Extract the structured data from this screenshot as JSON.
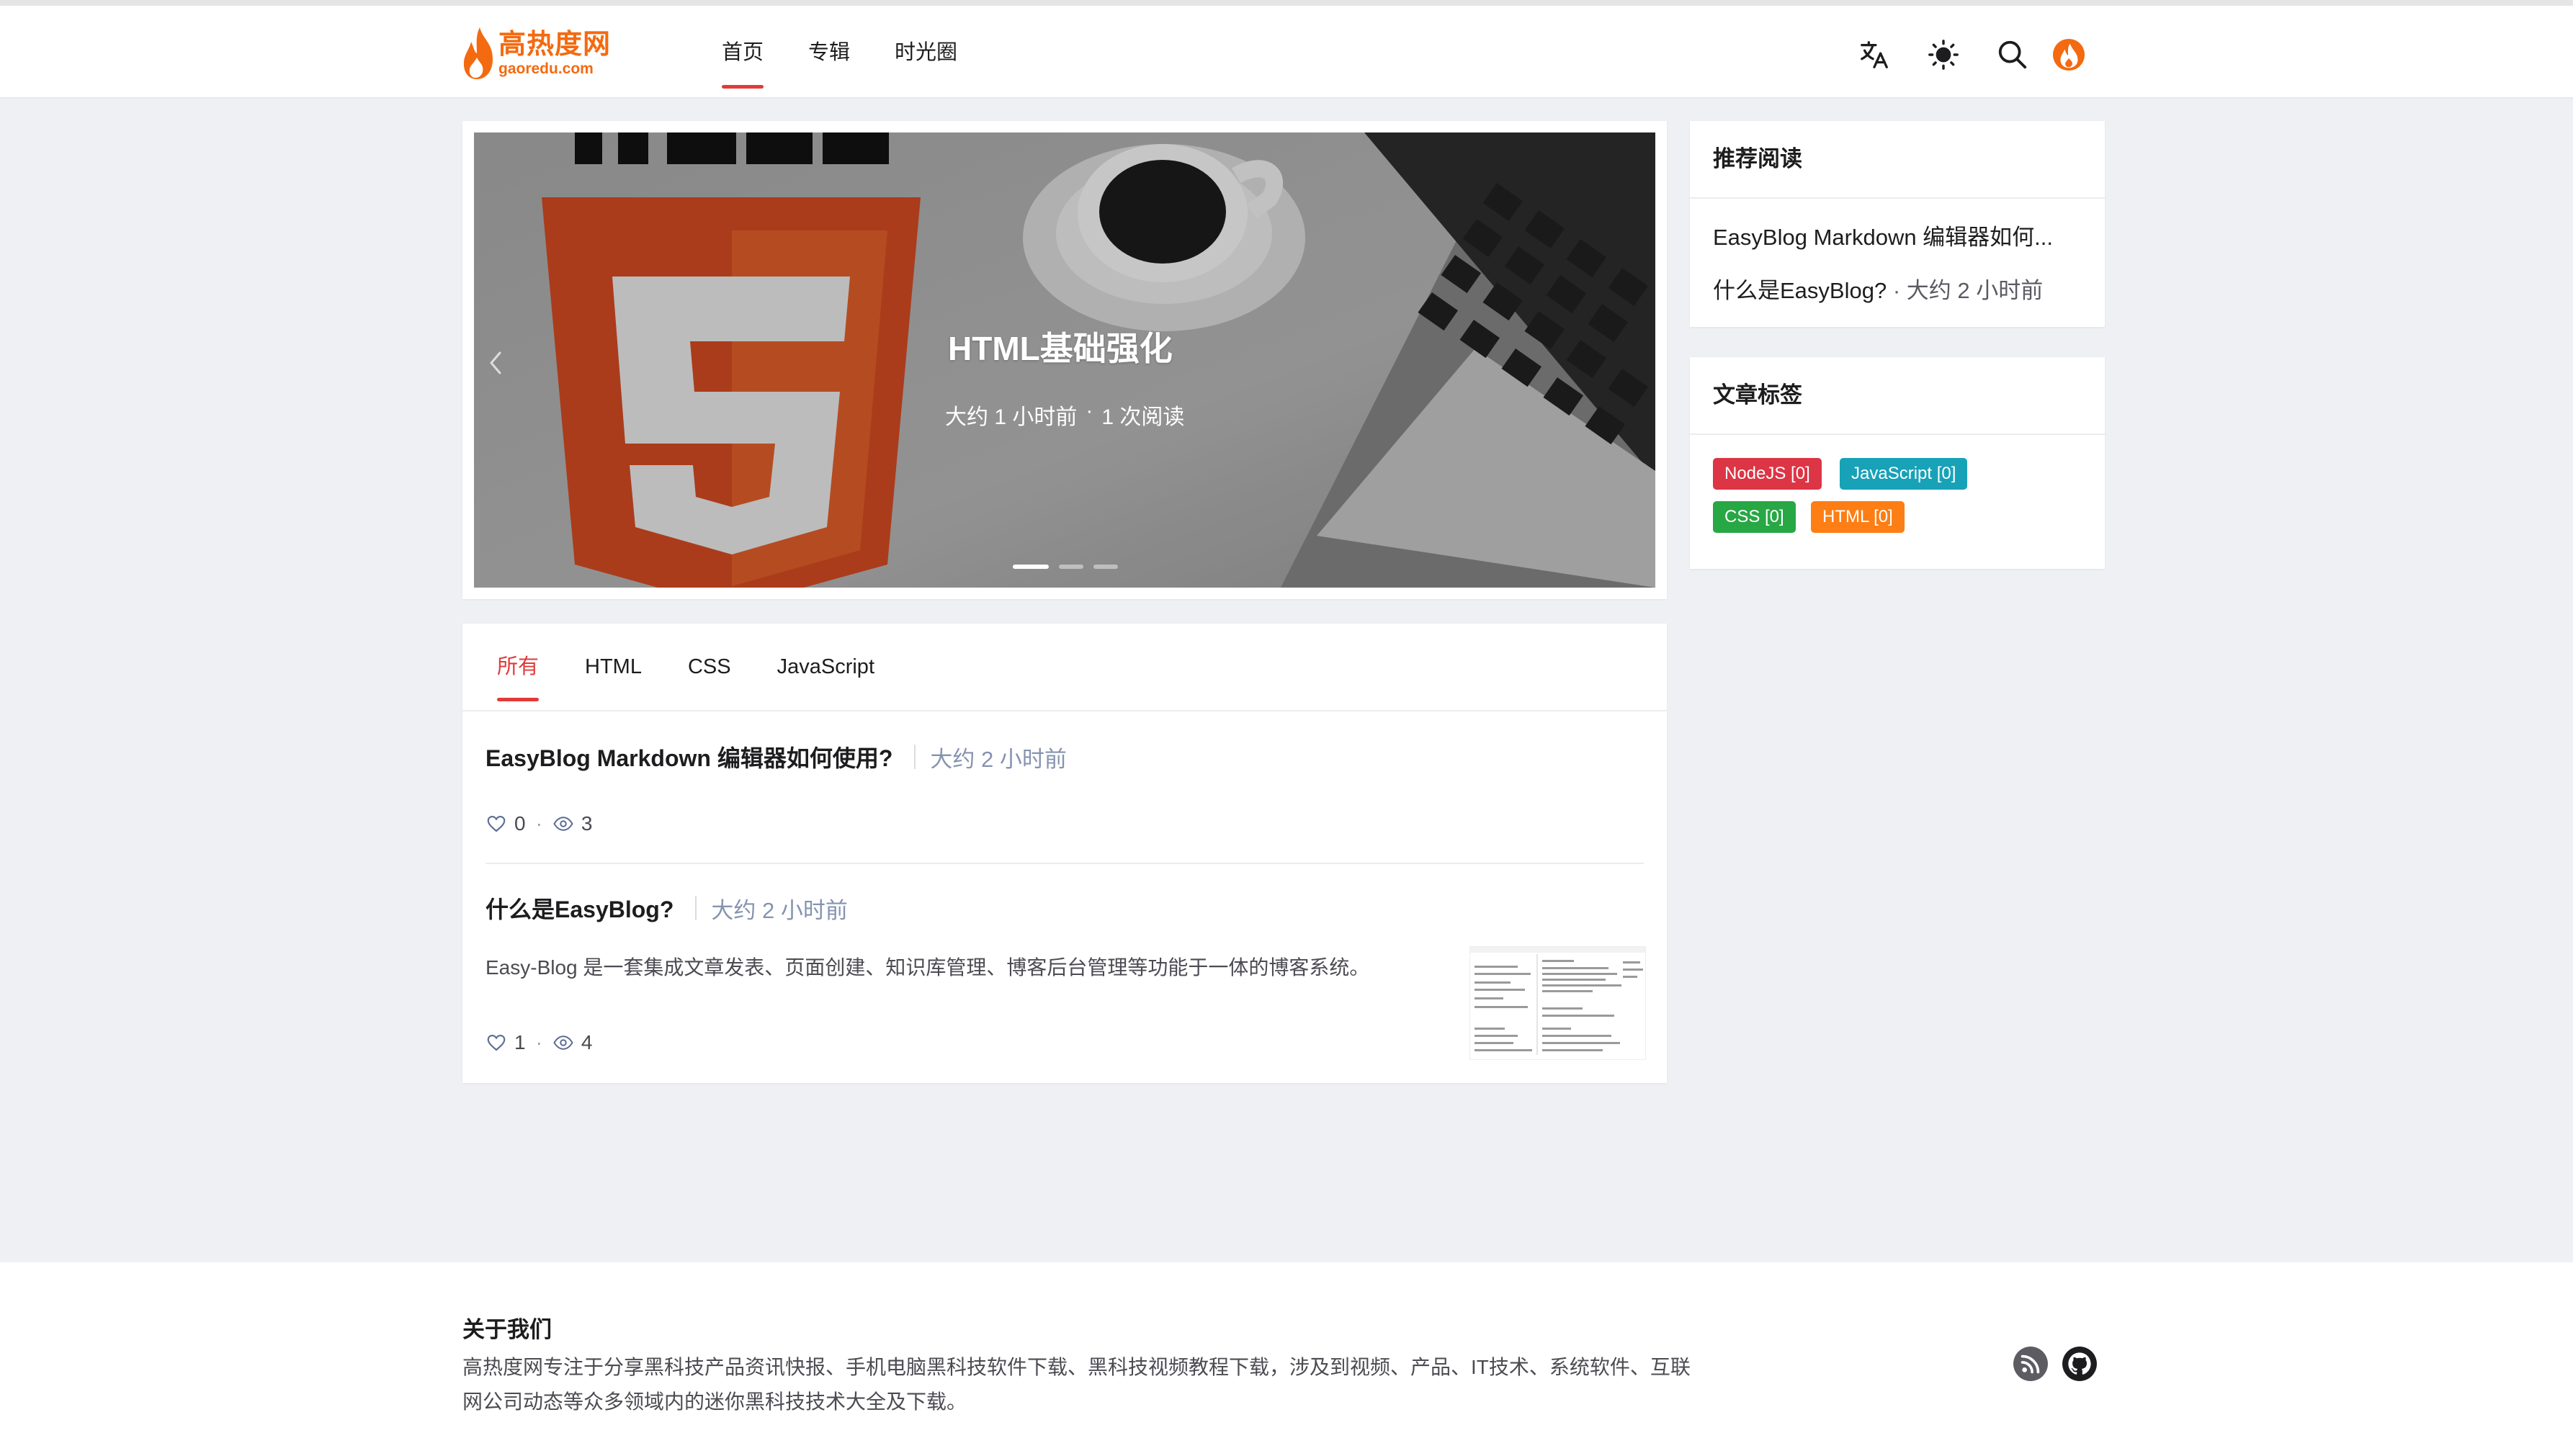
{
  "header": {
    "logo_cn": "高热度网",
    "logo_en": "gaoredu.com",
    "nav": [
      {
        "label": "首页",
        "active": true
      },
      {
        "label": "专辑",
        "active": false
      },
      {
        "label": "时光圈",
        "active": false
      }
    ],
    "icons": [
      "translate-icon",
      "theme-sun-icon",
      "search-icon",
      "avatar-flame-icon"
    ]
  },
  "carousel": {
    "slide_title": "HTML基础强化",
    "slide_time": "大约 1 小时前",
    "slide_separator": "·",
    "slide_reads": "1 次阅读",
    "image_text": "HTML",
    "image_badge": "5",
    "indicators": 3,
    "active_indicator": 0
  },
  "articles": {
    "tabs": [
      {
        "label": "所有",
        "active": true
      },
      {
        "label": "HTML",
        "active": false
      },
      {
        "label": "CSS",
        "active": false
      },
      {
        "label": "JavaScript",
        "active": false
      }
    ],
    "posts": [
      {
        "title": "EasyBlog Markdown 编辑器如何使用?",
        "time": "大约 2 小时前",
        "summary": "",
        "likes": "0",
        "views": "3"
      },
      {
        "title": "什么是EasyBlog?",
        "time": "大约 2 小时前",
        "summary": "Easy-Blog 是一套集成文章发表、页面创建、知识库管理、博客后台管理等功能于一体的博客系统。",
        "likes": "1",
        "views": "4"
      }
    ],
    "stat_separator": "·"
  },
  "sidebar": {
    "recommend": {
      "title": "推荐阅读",
      "items": [
        {
          "title": "EasyBlog Markdown 编辑器如何...",
          "time": ""
        },
        {
          "title": "什么是EasyBlog?",
          "time": "· 大约 2 小时前"
        }
      ]
    },
    "tags": {
      "title": "文章标签",
      "items": [
        {
          "label": "NodeJS [0]",
          "color": "#dc3545"
        },
        {
          "label": "JavaScript [0]",
          "color": "#17a2b8"
        },
        {
          "label": "CSS [0]",
          "color": "#28a745"
        },
        {
          "label": "HTML [0]",
          "color": "#fd7e14"
        }
      ]
    }
  },
  "footer": {
    "about_title": "关于我们",
    "about_text": "高热度网专注于分享黑科技产品资讯快报、手机电脑黑科技软件下载、黑科技视频教程下载，涉及到视频、产品、IT技术、系统软件、互联网公司动态等众多领域内的迷你黑科技技术大全及下载。",
    "icons": [
      "rss-icon",
      "github-icon"
    ]
  },
  "colors": {
    "accent": "#e23a3a",
    "brand": "#f36a10",
    "time_text": "#8593b0",
    "page_bg": "#eff0f3"
  }
}
